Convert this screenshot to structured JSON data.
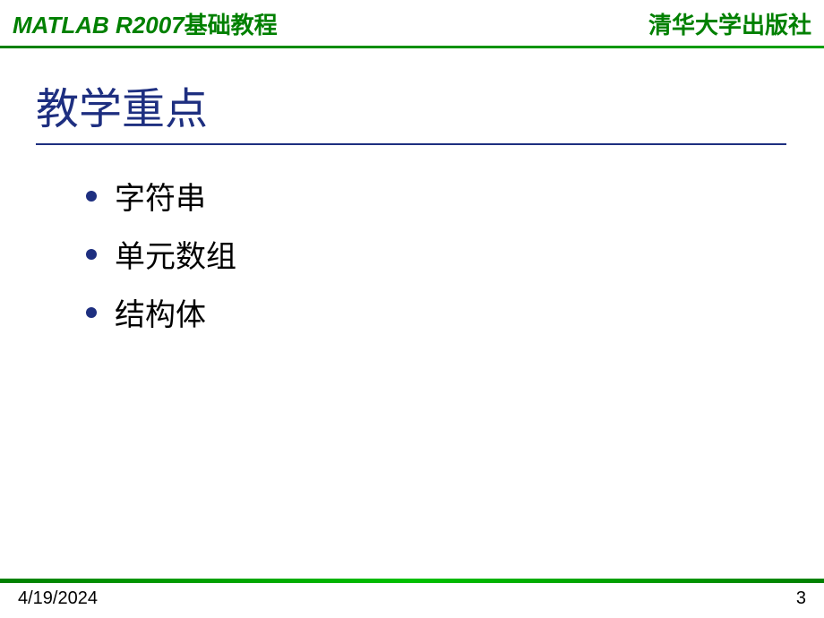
{
  "header": {
    "left_en": "MATLAB R2007",
    "left_cn": "基础教程",
    "right": "清华大学出版社"
  },
  "title": "教学重点",
  "bullets": [
    "字符串",
    "单元数组",
    "结构体"
  ],
  "footer": {
    "date": "4/19/2024",
    "page": "3"
  }
}
